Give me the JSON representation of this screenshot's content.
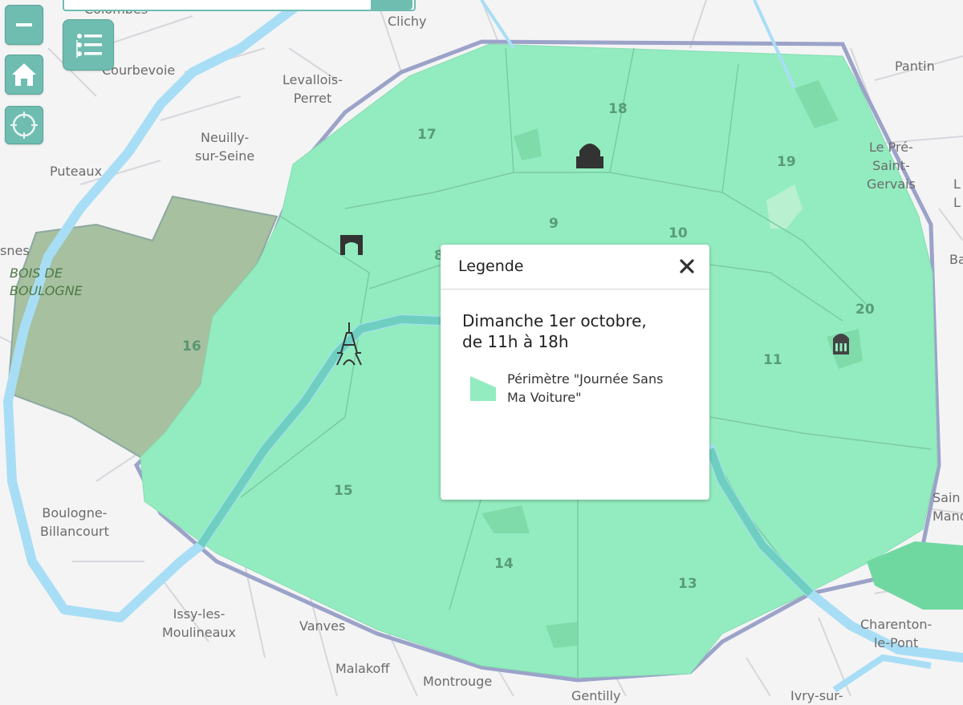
{
  "controls": {
    "zoom_out_icon": "minus-icon",
    "home_icon": "home-icon",
    "locate_icon": "locate-icon",
    "layers_icon": "layer-list-icon"
  },
  "colors": {
    "zone": "#93ecc0",
    "bois": "#a6c0a0",
    "water": "#a8def5",
    "accent": "#6fbcb0"
  },
  "places": {
    "colombes": "Colombes",
    "clichy": "Clichy",
    "pantin": "Pantin",
    "courbevoie": "Courbevoie",
    "levallois": "Levallois-\nPerret",
    "neuilly": "Neuilly-\nsur-Seine",
    "puteaux": "Puteaux",
    "le_pre": "Le Pré-\nSaint-\nGervais",
    "bois": "BOIS DE\nBOULOGNE",
    "snes": "snes",
    "boulogne": "Boulogne-\nBillancourt",
    "issy": "Issy-les-\nMoulineaux",
    "vanves": "Vanves",
    "malakoff": "Malakoff",
    "montrouge": "Montrouge",
    "gentilly": "Gentilly",
    "ivry": "Ivry-sur-",
    "charenton": "Charenton-\nle-Pont",
    "saint_mande": "Sain\nMand",
    "ba": "Ba",
    "l": "L\nL"
  },
  "arrondissements": {
    "a8": "8",
    "a9": "9",
    "a10": "10",
    "a11": "11",
    "a13": "13",
    "a14": "14",
    "a15": "15",
    "a16": "16",
    "a17": "17",
    "a18": "18",
    "a19": "19",
    "a20": "20"
  },
  "landmarks": [
    "arc-de-triomphe-icon",
    "eiffel-tower-icon",
    "sacre-coeur-icon",
    "pere-lachaise-icon"
  ],
  "popup": {
    "title": "Legende",
    "date_line1": "Dimanche 1er octobre,",
    "date_line2": "de 11h à 18h",
    "legend_label": "Périmètre \"Journée Sans Ma Voiture\""
  }
}
